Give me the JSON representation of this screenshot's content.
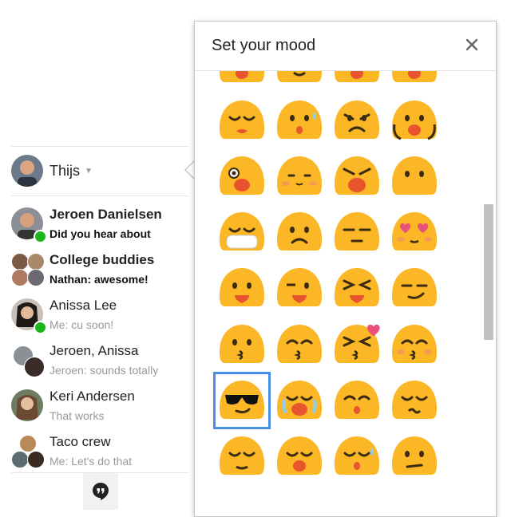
{
  "user": {
    "name": "Thijs"
  },
  "conversations": [
    {
      "title": "Jeroen Danielsen",
      "snippet": "Did you hear about",
      "unread": true,
      "online": true
    },
    {
      "title": "College buddies",
      "snippet": "Nathan: awesome!",
      "unread": true,
      "online": false
    },
    {
      "title": "Anissa Lee",
      "snippet": "Me: cu soon!",
      "unread": false,
      "online": true
    },
    {
      "title": "Jeroen, Anissa",
      "snippet": "Jeroen: sounds totally",
      "unread": false,
      "online": false
    },
    {
      "title": "Keri Andersen",
      "snippet": "That works",
      "unread": false,
      "online": false
    },
    {
      "title": "Taco crew",
      "snippet": "Me: Let's do that",
      "unread": false,
      "online": false
    }
  ],
  "mood_popup": {
    "title": "Set your mood",
    "close_icon": "close-icon",
    "selected_emoji": "cool-sunglasses"
  },
  "emojis": [
    "frown-open",
    "sweat-smile",
    "open-frown",
    "sweat-open",
    "sad-pout",
    "worried-sweat",
    "confounded",
    "screaming-hands",
    "dizzy-shout",
    "blushing",
    "tired-scream",
    "neutral-blank",
    "face-mask",
    "frowning",
    "unamused",
    "heart-eyes",
    "tongue-out",
    "winking-tongue",
    "squinting-tongue",
    "smirking",
    "kissing",
    "kissing-closed-eyes",
    "kissing-heart",
    "kissing-blush",
    "cool-sunglasses",
    "crying-loud",
    "kiss-relaxed",
    "confused-squint",
    "relieved",
    "yawning",
    "sleepy-sweat",
    "grimace"
  ],
  "colors": {
    "emoji_yellow": "#fbb725",
    "emoji_dark": "#3b2b10",
    "emoji_mouth": "#e8542e",
    "blush": "#f58c63",
    "online_green": "#1db51d",
    "selection_blue": "#4a90e2"
  }
}
